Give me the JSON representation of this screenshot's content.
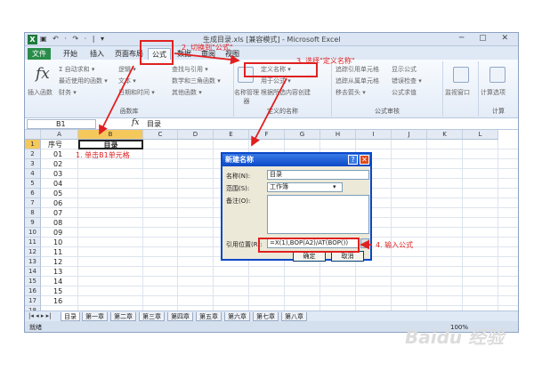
{
  "window": {
    "title": "生成目录.xls [兼容模式] - Microsoft Excel",
    "quick_access": "▣ ↶ · ↷ · | ▾",
    "controls": "─ ▢ ✕"
  },
  "tabs": [
    "文件",
    "开始",
    "插入",
    "页面布局",
    "公式",
    "数据",
    "审阅",
    "视图"
  ],
  "ribbon": {
    "insert_function": "插入函数",
    "autosum": "Σ 自动求和 ▾",
    "recent": "最近使用的函数 ▾",
    "finance": "财务 ▾",
    "logic": "逻辑 ▾",
    "text": "文本 ▾",
    "datetime": "日期和时间 ▾",
    "lookup": "查找与引用 ▾",
    "math": "数学和三角函数 ▾",
    "other": "其他函数 ▾",
    "group_library": "函数库",
    "name_manager": "名称管理器",
    "define_name": "定义名称 ▾",
    "use_in_formula": "用于公式 ▾",
    "create_from_sel": "根据所选内容创建",
    "group_names": "定义的名称",
    "trace_precedents": "追踪引用单元格",
    "trace_dependents": "追踪从属单元格",
    "remove_arrows": "移去箭头 ▾",
    "show_formulas": "显示公式",
    "error_check": "错误检查 ▾",
    "eval_formula": "公式求值",
    "group_audit": "公式审核",
    "watch_window": "监视窗口",
    "calc_options": "计算选项",
    "group_calc": "计算"
  },
  "formula_bar": {
    "name_box": "B1",
    "fx": "fx",
    "value": "目录"
  },
  "columns": [
    "A",
    "B",
    "C",
    "D",
    "E",
    "F",
    "G",
    "H",
    "I",
    "J",
    "K",
    "L"
  ],
  "rows": [
    "1",
    "2",
    "3",
    "4",
    "5",
    "6",
    "7",
    "8",
    "9",
    "10",
    "11",
    "12",
    "13",
    "14",
    "15",
    "16",
    "17",
    "18"
  ],
  "cells": {
    "a1": "序号",
    "b1": "目录",
    "a_values": [
      "01",
      "02",
      "03",
      "04",
      "05",
      "06",
      "07",
      "08",
      "09",
      "10",
      "11",
      "12",
      "13",
      "14",
      "15",
      "16"
    ]
  },
  "sheet_nav": "|◂ ◂ ▸ ▸|",
  "sheets": [
    "目录",
    "第一章",
    "第二章",
    "第三章",
    "第四章",
    "第五章",
    "第六章",
    "第七章",
    "第八章"
  ],
  "status": {
    "mode": "就绪",
    "zoom": "100%"
  },
  "dialog": {
    "title": "新建名称",
    "help": "?",
    "close": "✕",
    "name_label": "名称(N):",
    "name_value": "目录",
    "scope_label": "范围(S):",
    "scope_value": "工作簿",
    "comment_label": "备注(O):",
    "ref_label": "引用位置(R):",
    "ref_value": "=X(1),BOP(A2)/AT(BOP())",
    "ok": "确定",
    "cancel": "取消"
  },
  "annotations": {
    "step1": "1. 单击B1单元格",
    "step2": "2. 切换到\"公式\"",
    "step3": "3. 选择\"定义名称\"",
    "step4": "4. 输入公式"
  },
  "watermark": "Baidu 经验",
  "colors": {
    "annotation": "#e02020",
    "dialog_title": "#0a48c7",
    "file_tab": "#2a8c4a"
  }
}
